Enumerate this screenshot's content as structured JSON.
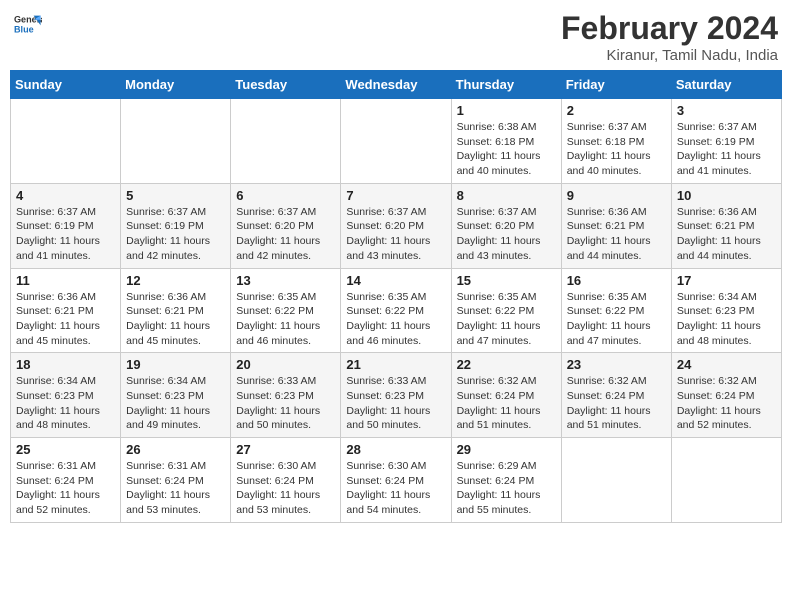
{
  "header": {
    "logo_line1": "General",
    "logo_line2": "Blue",
    "month_year": "February 2024",
    "location": "Kiranur, Tamil Nadu, India"
  },
  "weekdays": [
    "Sunday",
    "Monday",
    "Tuesday",
    "Wednesday",
    "Thursday",
    "Friday",
    "Saturday"
  ],
  "weeks": [
    [
      {
        "day": "",
        "info": ""
      },
      {
        "day": "",
        "info": ""
      },
      {
        "day": "",
        "info": ""
      },
      {
        "day": "",
        "info": ""
      },
      {
        "day": "1",
        "info": "Sunrise: 6:38 AM\nSunset: 6:18 PM\nDaylight: 11 hours\nand 40 minutes."
      },
      {
        "day": "2",
        "info": "Sunrise: 6:37 AM\nSunset: 6:18 PM\nDaylight: 11 hours\nand 40 minutes."
      },
      {
        "day": "3",
        "info": "Sunrise: 6:37 AM\nSunset: 6:19 PM\nDaylight: 11 hours\nand 41 minutes."
      }
    ],
    [
      {
        "day": "4",
        "info": "Sunrise: 6:37 AM\nSunset: 6:19 PM\nDaylight: 11 hours\nand 41 minutes."
      },
      {
        "day": "5",
        "info": "Sunrise: 6:37 AM\nSunset: 6:19 PM\nDaylight: 11 hours\nand 42 minutes."
      },
      {
        "day": "6",
        "info": "Sunrise: 6:37 AM\nSunset: 6:20 PM\nDaylight: 11 hours\nand 42 minutes."
      },
      {
        "day": "7",
        "info": "Sunrise: 6:37 AM\nSunset: 6:20 PM\nDaylight: 11 hours\nand 43 minutes."
      },
      {
        "day": "8",
        "info": "Sunrise: 6:37 AM\nSunset: 6:20 PM\nDaylight: 11 hours\nand 43 minutes."
      },
      {
        "day": "9",
        "info": "Sunrise: 6:36 AM\nSunset: 6:21 PM\nDaylight: 11 hours\nand 44 minutes."
      },
      {
        "day": "10",
        "info": "Sunrise: 6:36 AM\nSunset: 6:21 PM\nDaylight: 11 hours\nand 44 minutes."
      }
    ],
    [
      {
        "day": "11",
        "info": "Sunrise: 6:36 AM\nSunset: 6:21 PM\nDaylight: 11 hours\nand 45 minutes."
      },
      {
        "day": "12",
        "info": "Sunrise: 6:36 AM\nSunset: 6:21 PM\nDaylight: 11 hours\nand 45 minutes."
      },
      {
        "day": "13",
        "info": "Sunrise: 6:35 AM\nSunset: 6:22 PM\nDaylight: 11 hours\nand 46 minutes."
      },
      {
        "day": "14",
        "info": "Sunrise: 6:35 AM\nSunset: 6:22 PM\nDaylight: 11 hours\nand 46 minutes."
      },
      {
        "day": "15",
        "info": "Sunrise: 6:35 AM\nSunset: 6:22 PM\nDaylight: 11 hours\nand 47 minutes."
      },
      {
        "day": "16",
        "info": "Sunrise: 6:35 AM\nSunset: 6:22 PM\nDaylight: 11 hours\nand 47 minutes."
      },
      {
        "day": "17",
        "info": "Sunrise: 6:34 AM\nSunset: 6:23 PM\nDaylight: 11 hours\nand 48 minutes."
      }
    ],
    [
      {
        "day": "18",
        "info": "Sunrise: 6:34 AM\nSunset: 6:23 PM\nDaylight: 11 hours\nand 48 minutes."
      },
      {
        "day": "19",
        "info": "Sunrise: 6:34 AM\nSunset: 6:23 PM\nDaylight: 11 hours\nand 49 minutes."
      },
      {
        "day": "20",
        "info": "Sunrise: 6:33 AM\nSunset: 6:23 PM\nDaylight: 11 hours\nand 50 minutes."
      },
      {
        "day": "21",
        "info": "Sunrise: 6:33 AM\nSunset: 6:23 PM\nDaylight: 11 hours\nand 50 minutes."
      },
      {
        "day": "22",
        "info": "Sunrise: 6:32 AM\nSunset: 6:24 PM\nDaylight: 11 hours\nand 51 minutes."
      },
      {
        "day": "23",
        "info": "Sunrise: 6:32 AM\nSunset: 6:24 PM\nDaylight: 11 hours\nand 51 minutes."
      },
      {
        "day": "24",
        "info": "Sunrise: 6:32 AM\nSunset: 6:24 PM\nDaylight: 11 hours\nand 52 minutes."
      }
    ],
    [
      {
        "day": "25",
        "info": "Sunrise: 6:31 AM\nSunset: 6:24 PM\nDaylight: 11 hours\nand 52 minutes."
      },
      {
        "day": "26",
        "info": "Sunrise: 6:31 AM\nSunset: 6:24 PM\nDaylight: 11 hours\nand 53 minutes."
      },
      {
        "day": "27",
        "info": "Sunrise: 6:30 AM\nSunset: 6:24 PM\nDaylight: 11 hours\nand 53 minutes."
      },
      {
        "day": "28",
        "info": "Sunrise: 6:30 AM\nSunset: 6:24 PM\nDaylight: 11 hours\nand 54 minutes."
      },
      {
        "day": "29",
        "info": "Sunrise: 6:29 AM\nSunset: 6:24 PM\nDaylight: 11 hours\nand 55 minutes."
      },
      {
        "day": "",
        "info": ""
      },
      {
        "day": "",
        "info": ""
      }
    ]
  ]
}
